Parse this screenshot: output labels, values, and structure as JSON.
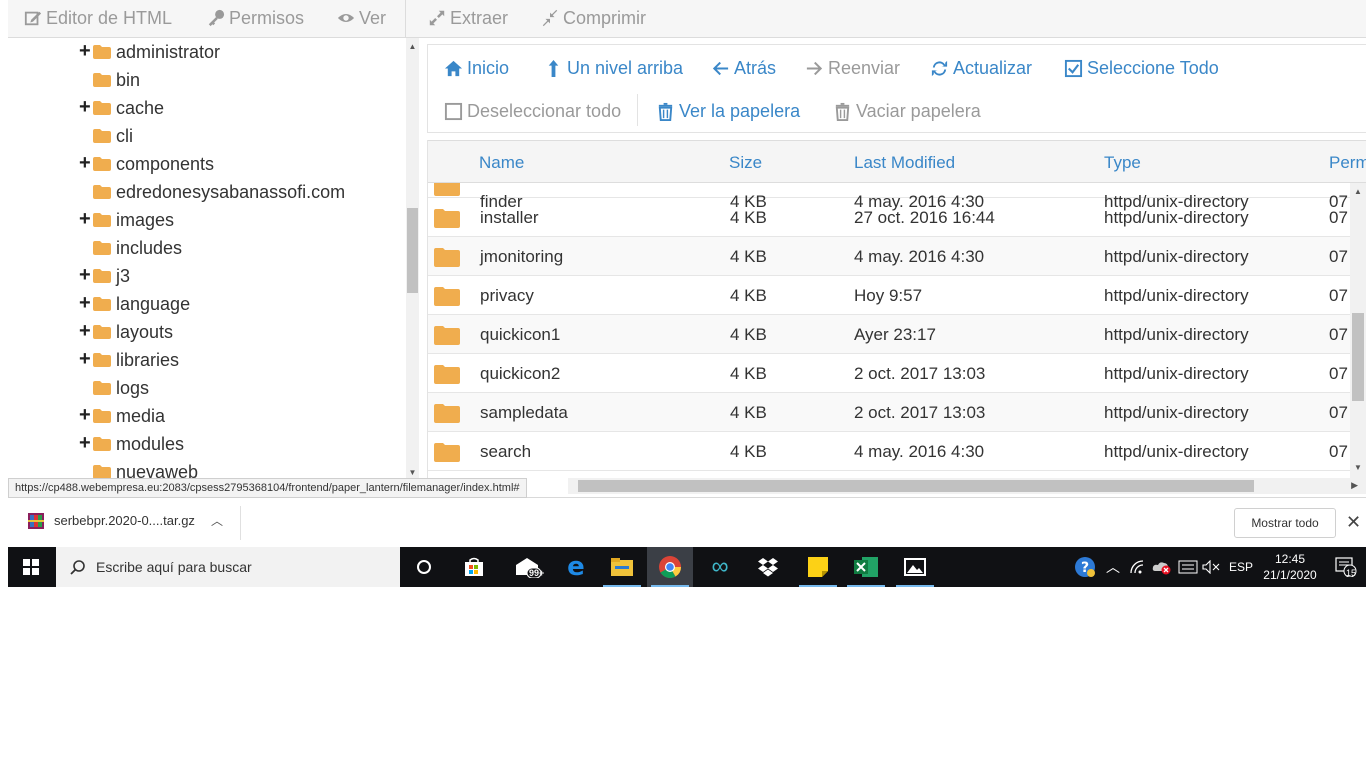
{
  "toolbar": {
    "html_editor": "Editor de HTML",
    "permissions": "Permisos",
    "view": "Ver",
    "extract": "Extraer",
    "compress": "Comprimir"
  },
  "tree": {
    "items": [
      {
        "label": "administrator",
        "expandable": true
      },
      {
        "label": "bin",
        "expandable": false
      },
      {
        "label": "cache",
        "expandable": true
      },
      {
        "label": "cli",
        "expandable": false
      },
      {
        "label": "components",
        "expandable": true
      },
      {
        "label": "edredonesysabanassofi.com",
        "expandable": false
      },
      {
        "label": "images",
        "expandable": true
      },
      {
        "label": "includes",
        "expandable": false
      },
      {
        "label": "j3",
        "expandable": true
      },
      {
        "label": "language",
        "expandable": true
      },
      {
        "label": "layouts",
        "expandable": true
      },
      {
        "label": "libraries",
        "expandable": true
      },
      {
        "label": "logs",
        "expandable": false
      },
      {
        "label": "media",
        "expandable": true
      },
      {
        "label": "modules",
        "expandable": true
      },
      {
        "label": "nuevaweb",
        "expandable": false
      }
    ]
  },
  "actions": {
    "home": "Inicio",
    "up_level": "Un nivel arriba",
    "back": "Atrás",
    "forward": "Reenviar",
    "refresh": "Actualizar",
    "select_all": "Seleccione Todo",
    "deselect_all": "Deseleccionar todo",
    "view_trash": "Ver la papelera",
    "empty_trash": "Vaciar papelera"
  },
  "table": {
    "columns": {
      "name": "Name",
      "size": "Size",
      "modified": "Last Modified",
      "type": "Type",
      "perms": "Perm"
    },
    "partial_row": {
      "name": "finder",
      "size": "4 KB",
      "modified": "4 may. 2016 4:30",
      "type": "httpd/unix-directory",
      "perms": "07"
    },
    "rows": [
      {
        "name": "installer",
        "size": "4 KB",
        "modified": "27 oct. 2016 16:44",
        "type": "httpd/unix-directory",
        "perms": "07"
      },
      {
        "name": "jmonitoring",
        "size": "4 KB",
        "modified": "4 may. 2016 4:30",
        "type": "httpd/unix-directory",
        "perms": "07"
      },
      {
        "name": "privacy",
        "size": "4 KB",
        "modified": "Hoy 9:57",
        "type": "httpd/unix-directory",
        "perms": "07"
      },
      {
        "name": "quickicon1",
        "size": "4 KB",
        "modified": "Ayer 23:17",
        "type": "httpd/unix-directory",
        "perms": "07"
      },
      {
        "name": "quickicon2",
        "size": "4 KB",
        "modified": "2 oct. 2017 13:03",
        "type": "httpd/unix-directory",
        "perms": "07"
      },
      {
        "name": "sampledata",
        "size": "4 KB",
        "modified": "2 oct. 2017 13:03",
        "type": "httpd/unix-directory",
        "perms": "07"
      },
      {
        "name": "search",
        "size": "4 KB",
        "modified": "4 may. 2016 4:30",
        "type": "httpd/unix-directory",
        "perms": "07"
      }
    ]
  },
  "status_url": "https://cp488.webempresa.eu:2083/cpsess2795368104/frontend/paper_lantern/filemanager/index.html#",
  "downloads": {
    "file": "serbebpr.2020-0....tar.gz",
    "show_all": "Mostrar todo"
  },
  "taskbar": {
    "search_placeholder": "Escribe aquí para buscar",
    "mail_badge": "99+",
    "language": "ESP",
    "time": "12:45",
    "date": "21/1/2020",
    "notifications": "15"
  },
  "colors": {
    "accent": "#3a87c8",
    "folder": "#f0ad4e",
    "taskbar": "#101114"
  }
}
